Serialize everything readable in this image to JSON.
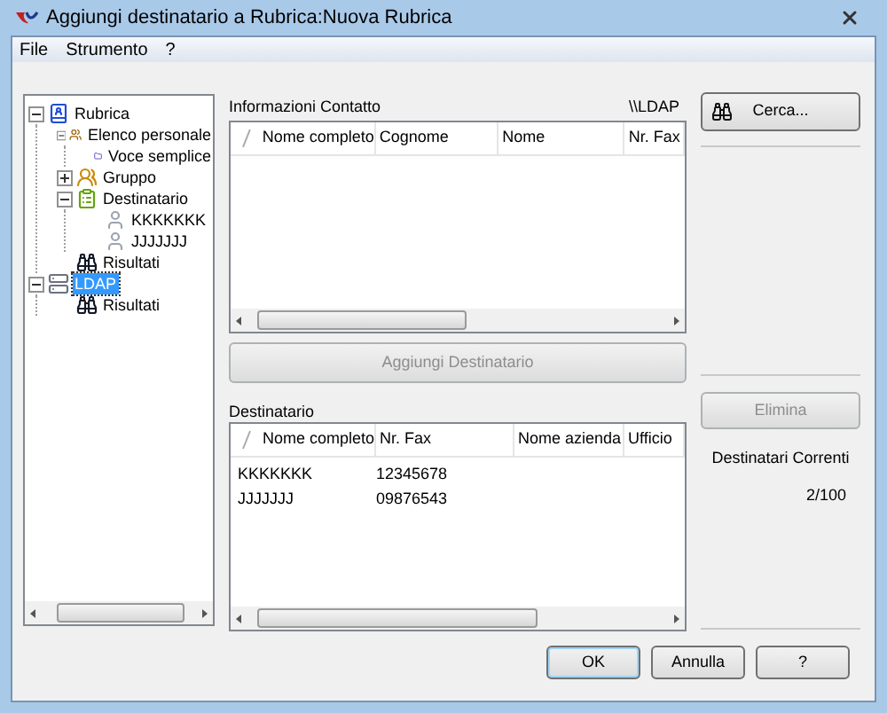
{
  "window": {
    "title": "Aggiungi destinatario a Rubrica:Nuova Rubrica"
  },
  "menu": [
    {
      "label": "File"
    },
    {
      "label": "Strumento"
    },
    {
      "label": "?"
    }
  ],
  "tree": [
    {
      "label": "Rubrica",
      "kind": "book",
      "expanded": true,
      "selected": false,
      "children": [
        {
          "label": "Elenco personale",
          "kind": "people",
          "expanded": true,
          "selected": false,
          "children": [
            {
              "label": "Voce semplice",
              "kind": "folder",
              "selected": false
            }
          ]
        },
        {
          "label": "Gruppo",
          "kind": "group",
          "expanded": false,
          "selected": false
        },
        {
          "label": "Destinatario",
          "kind": "recipients",
          "expanded": true,
          "selected": false,
          "children": [
            {
              "label": "KKKKKKK",
              "kind": "person",
              "selected": false
            },
            {
              "label": "JJJJJJJ",
              "kind": "person",
              "selected": false
            }
          ]
        },
        {
          "label": "Risultati",
          "kind": "results",
          "selected": false
        }
      ]
    },
    {
      "label": "LDAP",
      "kind": "server",
      "expanded": true,
      "selected": true,
      "children": [
        {
          "label": "Risultati",
          "kind": "results",
          "selected": false
        }
      ]
    }
  ],
  "contact_info": {
    "label": "Informazioni Contatto",
    "path": "\\\\LDAP",
    "columns": [
      "Nome completo",
      "Cognome",
      "Nome",
      "Nr. Fax"
    ]
  },
  "add_button": {
    "label": "Aggiungi Destinatario",
    "disabled": true
  },
  "search_button": {
    "label": "Cerca..."
  },
  "recipients": {
    "label": "Destinatario",
    "columns": [
      "Nome completo",
      "Nr. Fax",
      "Nome azienda",
      "Ufficio"
    ],
    "rows": [
      [
        "KKKKKKK",
        "12345678"
      ],
      [
        "JJJJJJJ",
        "09876543"
      ]
    ]
  },
  "delete_button": {
    "label": "Elimina",
    "disabled": true
  },
  "current": {
    "label": "Destinatari Correnti",
    "value": "2/100"
  },
  "buttons": [
    {
      "label": "OK",
      "default": true
    },
    {
      "label": "Annulla",
      "default": false
    },
    {
      "label": "?",
      "default": false
    }
  ]
}
